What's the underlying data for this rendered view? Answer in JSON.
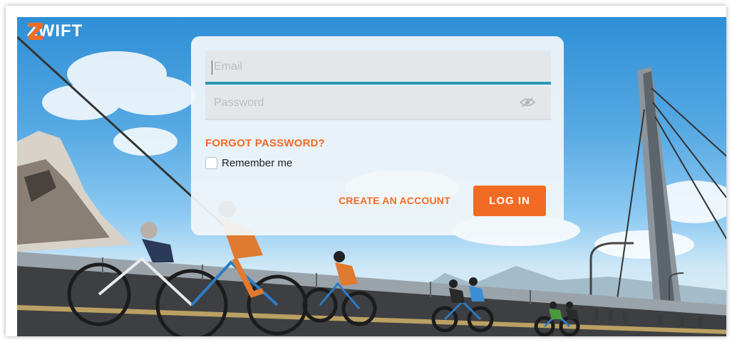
{
  "brand": {
    "logo_text": "ZWIFT",
    "accent": "#f26b24",
    "focus_color": "#2b97b4"
  },
  "form": {
    "email_placeholder": "Email",
    "email_value": "",
    "password_placeholder": "Password",
    "password_value": "",
    "password_toggle_icon": "eye-slash-icon",
    "forgot_password": "FORGOT PASSWORD?",
    "remember_me": "Remember me",
    "remember_checked": false,
    "create_account": "CREATE AN ACCOUNT",
    "login_button": "LOG IN"
  },
  "background": {
    "description_icon": "cyclists-bridge-scene"
  }
}
